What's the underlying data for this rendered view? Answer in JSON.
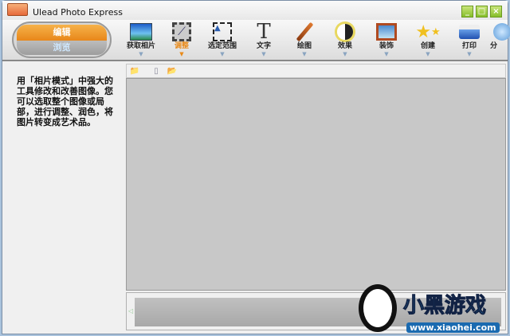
{
  "window": {
    "title": "Ulead Photo Express",
    "minimize": "_",
    "maximize": "□",
    "close": "×"
  },
  "mode": {
    "edit": "编辑",
    "browse": "浏览"
  },
  "tools": [
    {
      "label": "获取相片",
      "icon": "get-photo-icon"
    },
    {
      "label": "调整",
      "icon": "adjust-icon",
      "active": true
    },
    {
      "label": "选定范围",
      "icon": "select-icon"
    },
    {
      "label": "文字",
      "icon": "text-icon"
    },
    {
      "label": "绘图",
      "icon": "brush-icon"
    },
    {
      "label": "效果",
      "icon": "effect-icon"
    },
    {
      "label": "装饰",
      "icon": "decorate-icon"
    },
    {
      "label": "创建",
      "icon": "create-icon"
    },
    {
      "label": "打印",
      "icon": "print-icon"
    },
    {
      "label": "分",
      "icon": "share-icon"
    }
  ],
  "description": "用「相片模式」中强大的工具修改和改善图像。您可以选取整个图像或局部，进行调整、润色，将图片转变成艺术品。",
  "watermark": {
    "name": "小黑游戏",
    "url": "www.xiaohei.com"
  }
}
